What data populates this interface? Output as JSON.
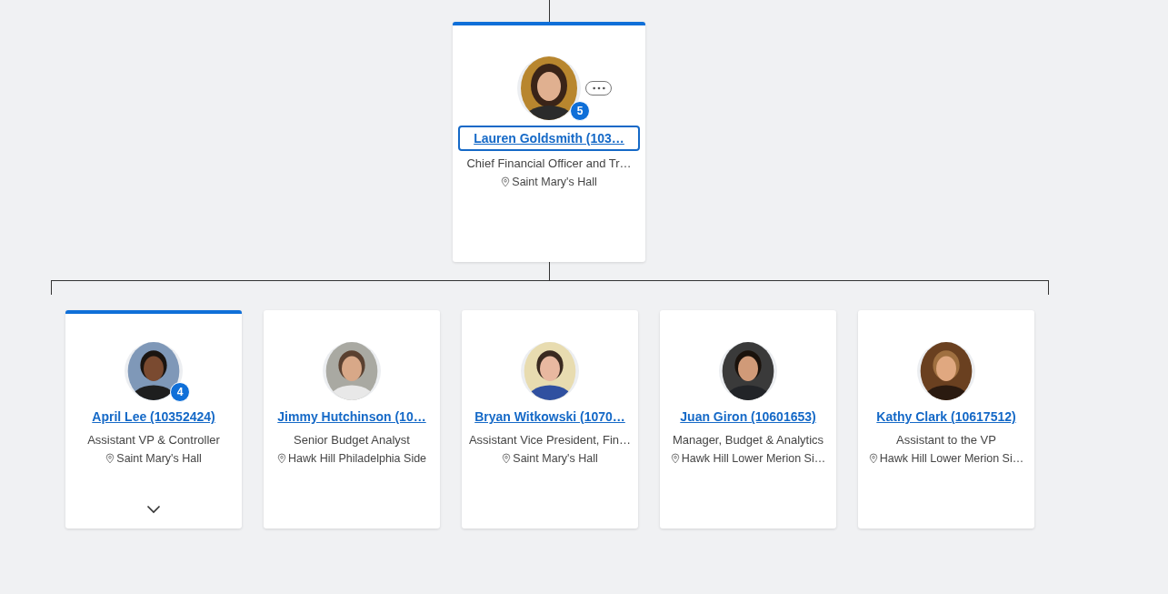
{
  "manager": {
    "name": "Lauren Goldsmith (103…",
    "title": "Chief Financial Officer and Tr…",
    "location": "Saint Mary's Hall",
    "reports_count": "5",
    "selected": true,
    "focused": true,
    "kind": "picture"
  },
  "reports": [
    {
      "name": "April Lee (10352424)",
      "title": "Assistant VP & Controller",
      "location": "Saint Mary's Hall",
      "reports_count": "4",
      "selected": true,
      "expandable": true,
      "kind": "picture"
    },
    {
      "name": "Jimmy Hutchinson (10…",
      "title": "Senior Budget Analyst",
      "location": "Hawk Hill Philadelphia Side",
      "selected": false,
      "expandable": false,
      "kind": "picture"
    },
    {
      "name": "Bryan Witkowski (1070…",
      "title": "Assistant Vice President, Fin…",
      "location": "Saint Mary's Hall",
      "selected": false,
      "expandable": false,
      "kind": "picture"
    },
    {
      "name": "Juan Giron (10601653)",
      "title": "Manager, Budget & Analytics",
      "location": "Hawk Hill Lower Merion Si…",
      "selected": false,
      "expandable": false,
      "kind": "picture"
    },
    {
      "name": "Kathy Clark (10617512)",
      "title": "Assistant to the VP",
      "location": "Hawk Hill Lower Merion Si…",
      "selected": false,
      "expandable": false,
      "kind": "picture"
    }
  ]
}
